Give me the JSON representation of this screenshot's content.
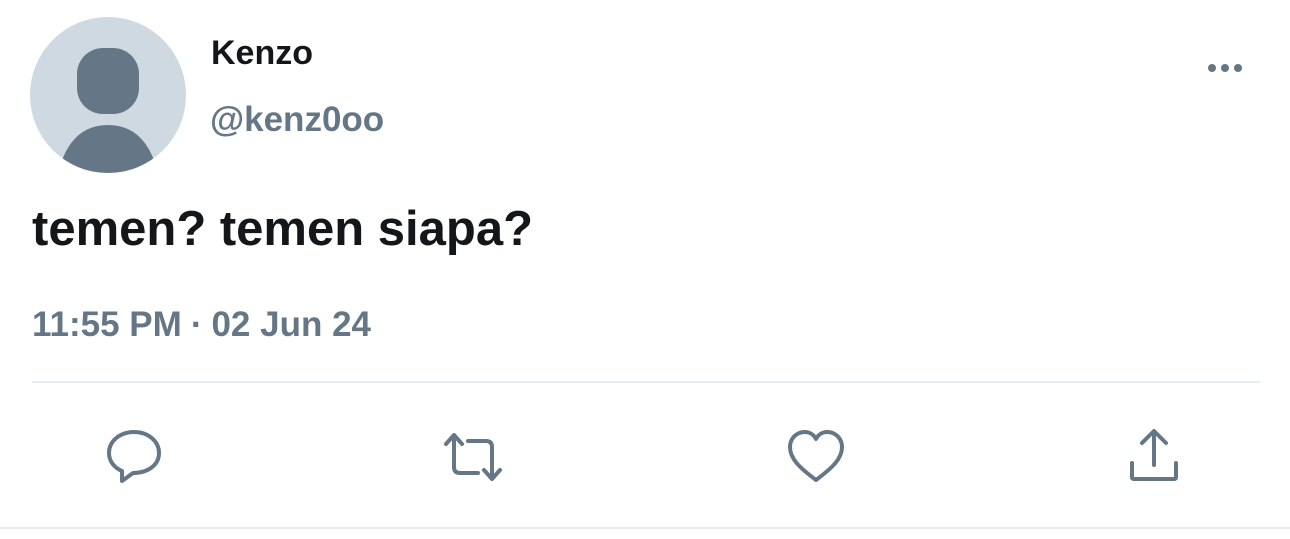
{
  "tweet": {
    "display_name": "Kenzo",
    "handle": "@kenz0oo",
    "text": "temen? temen siapa?",
    "time": "11:55 PM",
    "separator": "·",
    "date": "02 Jun 24"
  },
  "icons": {
    "more": "more-horizontal-icon",
    "reply": "reply-bubble-icon",
    "retweet": "retweet-arrows-icon",
    "like": "heart-icon",
    "share": "share-upload-icon"
  },
  "colors": {
    "text_primary": "#14171a",
    "text_secondary": "#657786",
    "avatar_bg": "#cfd9e1",
    "avatar_figure": "#657786",
    "divider": "#e6ecf0"
  }
}
